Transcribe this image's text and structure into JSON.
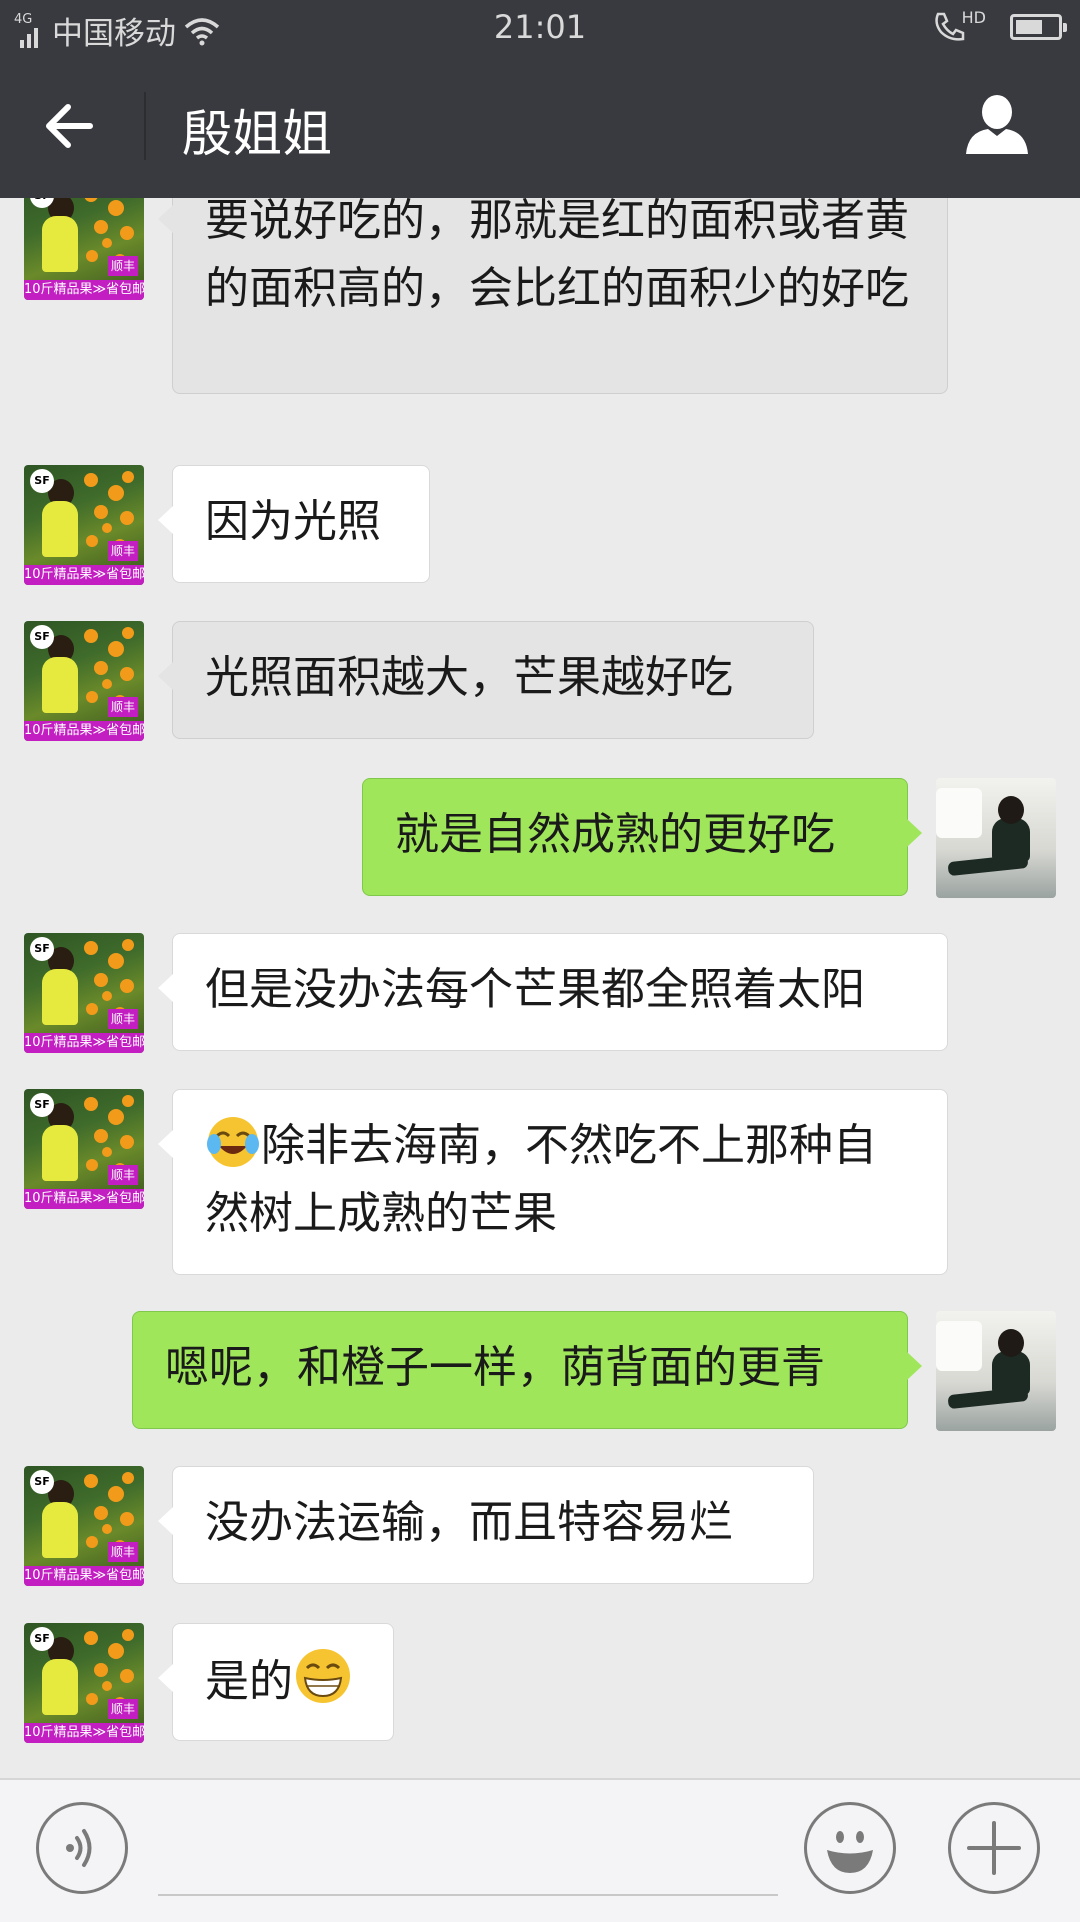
{
  "status_bar": {
    "network": "4G",
    "carrier": "中国移动",
    "time": "21:01",
    "hd_label": "HD",
    "battery_level": 0.65
  },
  "header": {
    "title": "殷姐姐"
  },
  "messages": [
    {
      "side": "left",
      "style": "grey",
      "text": "要说好吃的，那就是红的面积或者黄的面积高的，会比红的面积少的好吃"
    },
    {
      "side": "left",
      "style": "white",
      "text": "因为光照"
    },
    {
      "side": "left",
      "style": "grey",
      "text": "光照面积越大，芒果越好吃"
    },
    {
      "side": "right",
      "style": "green",
      "text": "就是自然成熟的更好吃"
    },
    {
      "side": "left",
      "style": "white",
      "text": "但是没办法每个芒果都全照着太阳"
    },
    {
      "side": "left",
      "style": "white",
      "emoji": "😭",
      "text": "除非去海南，不然吃不上那种自然树上成熟的芒果"
    },
    {
      "side": "right",
      "style": "green",
      "text": "嗯呢，和橙子一样，荫背面的更青"
    },
    {
      "side": "left",
      "style": "white",
      "text": "没办法运输，而且特容易烂"
    },
    {
      "side": "left",
      "style": "white",
      "text": "是的",
      "emoji_after": "😁"
    }
  ],
  "avatar_other": {
    "badge": "顺丰",
    "caption": "10斤精品果≫省包邮",
    "logo": "SF"
  },
  "icons": {
    "back": "arrow-left-icon",
    "profile": "person-icon",
    "voice": "voice-icon",
    "emoji": "smiley-icon",
    "more": "plus-icon"
  },
  "colors": {
    "bar_bg": "#393a3f",
    "chat_bg": "#ebebeb",
    "bubble_green": "#9fe65b",
    "bubble_white": "#ffffff",
    "bubble_grey": "#e4e4e4"
  }
}
